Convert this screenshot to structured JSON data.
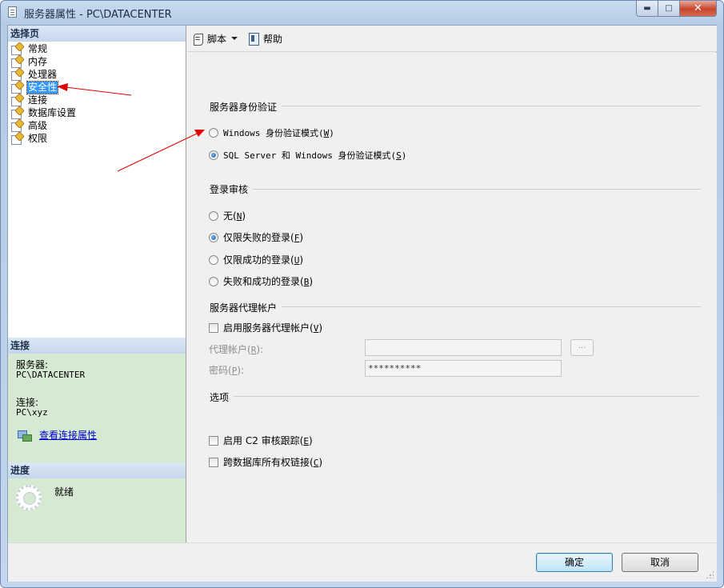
{
  "window": {
    "title": "服务器属性 - PC\\DATACENTER",
    "minimize_glyph": "▬",
    "maximize_glyph": "□",
    "close_glyph": "✕"
  },
  "left_pane": {
    "select_page_header": "选择页",
    "pages": [
      {
        "label": "常规",
        "selected": false
      },
      {
        "label": "内存",
        "selected": false
      },
      {
        "label": "处理器",
        "selected": false
      },
      {
        "label": "安全性",
        "selected": true
      },
      {
        "label": "连接",
        "selected": false
      },
      {
        "label": "数据库设置",
        "selected": false
      },
      {
        "label": "高级",
        "selected": false
      },
      {
        "label": "权限",
        "selected": false
      }
    ],
    "connection_header": "连接",
    "server_label": "服务器:",
    "server_value": "PC\\DATACENTER",
    "connection_label": "连接:",
    "connection_value": "PC\\xyz",
    "view_connection_link": "查看连接属性",
    "progress_header": "进度",
    "progress_status": "就绪"
  },
  "toolbar": {
    "script_label": "脚本",
    "help_label": "帮助"
  },
  "auth_group": {
    "title": "服务器身份验证",
    "windows_mode_text": "Windows 身份验证模式(",
    "windows_mode_key": "W",
    "mixed_mode_text": "SQL Server 和 Windows 身份验证模式(",
    "mixed_mode_key": "S",
    "selected": "mixed"
  },
  "audit_group": {
    "title": "登录审核",
    "options": [
      {
        "text": "无(",
        "key": "N",
        "selected": false
      },
      {
        "text": "仅限失败的登录(",
        "key": "F",
        "selected": true
      },
      {
        "text": "仅限成功的登录(",
        "key": "U",
        "selected": false
      },
      {
        "text": "失败和成功的登录(",
        "key": "B",
        "selected": false
      }
    ]
  },
  "proxy_group": {
    "title": "服务器代理帐户",
    "enable_text": "启用服务器代理帐户(",
    "enable_key": "V",
    "enabled": false,
    "account_label": "代理帐户(",
    "account_key": "R",
    "account_value": "",
    "password_label": "密码(",
    "password_key": "P",
    "password_value": "**********",
    "browse_label": "..."
  },
  "options_group": {
    "title": "选项",
    "c2_text": "启用 C2 审核跟踪(",
    "c2_key": "E",
    "c2_checked": false,
    "chain_text": "跨数据库所有权链接(",
    "chain_key": "C",
    "chain_checked": false
  },
  "buttons": {
    "ok": "确定",
    "cancel": "取消"
  },
  "colors": {
    "annotation_arrow": "#e00000",
    "selection": "#3399ff",
    "connection_panel": "#d6e9d2"
  }
}
